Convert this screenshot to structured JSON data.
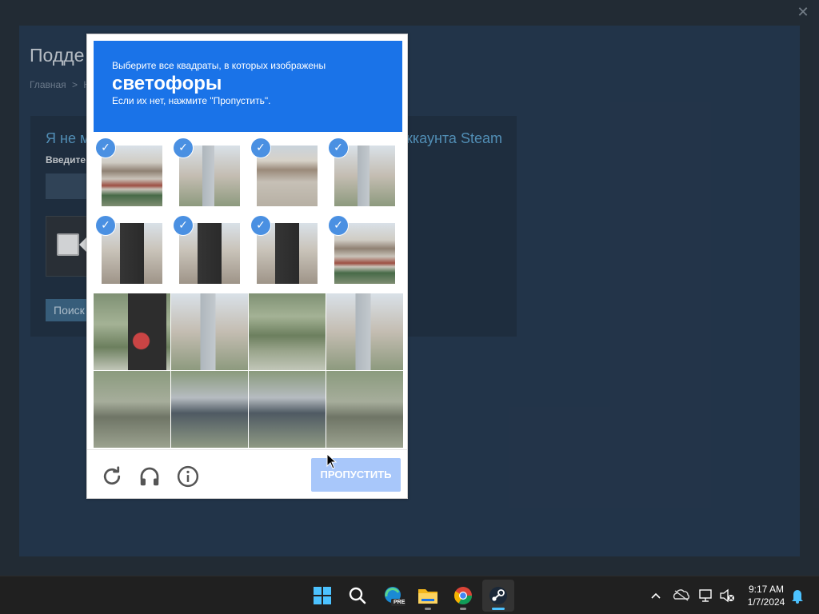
{
  "window": {
    "close_glyph": "✕"
  },
  "page": {
    "title": "Подде",
    "breadcrumb": {
      "home": "Главная",
      "separator": ">",
      "next": "Н"
    },
    "panel": {
      "heading": "Я не м",
      "heading_right": "ккаунта Steam",
      "label": "Введите",
      "search_button": "Поиск"
    }
  },
  "captcha": {
    "instruction_line1": "Выберите все квадраты, в которых изображены",
    "keyword": "светофоры",
    "instruction_line2": "Если их нет, нажмите \"Пропустить\".",
    "check_glyph": "✓",
    "tiles": [
      {
        "selected": true,
        "image": "img-store"
      },
      {
        "selected": true,
        "image": "img-pole"
      },
      {
        "selected": true,
        "image": "img-sky"
      },
      {
        "selected": true,
        "image": "img-pole"
      },
      {
        "selected": true,
        "image": "img-light"
      },
      {
        "selected": true,
        "image": "img-light"
      },
      {
        "selected": true,
        "image": "img-light"
      },
      {
        "selected": true,
        "image": "img-store"
      },
      {
        "selected": false,
        "image": "img-tree-light"
      },
      {
        "selected": false,
        "image": "img-pole"
      },
      {
        "selected": false,
        "image": "img-tree"
      },
      {
        "selected": false,
        "image": "img-pole"
      },
      {
        "selected": false,
        "image": "img-road"
      },
      {
        "selected": false,
        "image": "img-car"
      },
      {
        "selected": false,
        "image": "img-car"
      },
      {
        "selected": false,
        "image": "img-road"
      }
    ],
    "tools": [
      "reload-icon",
      "headphones-icon",
      "info-icon"
    ],
    "skip_button": "ПРОПУСТИТЬ",
    "colors": {
      "header": "#1a73e8",
      "skip_button": "#a8c7fa",
      "check": "#4a90e2"
    }
  },
  "taskbar": {
    "apps": [
      {
        "name": "windows-start-icon",
        "active": false
      },
      {
        "name": "search-icon",
        "active": false
      },
      {
        "name": "edge-preview-icon",
        "active": false,
        "badge": "PRE"
      },
      {
        "name": "file-explorer-icon",
        "active": false
      },
      {
        "name": "chrome-icon",
        "active": false
      },
      {
        "name": "steam-icon",
        "active": true
      }
    ],
    "tray": [
      "chevron-up-icon",
      "onedrive-icon",
      "display-icon",
      "speaker-muted-icon"
    ],
    "time": "9:17 AM",
    "date": "1/7/2024"
  }
}
